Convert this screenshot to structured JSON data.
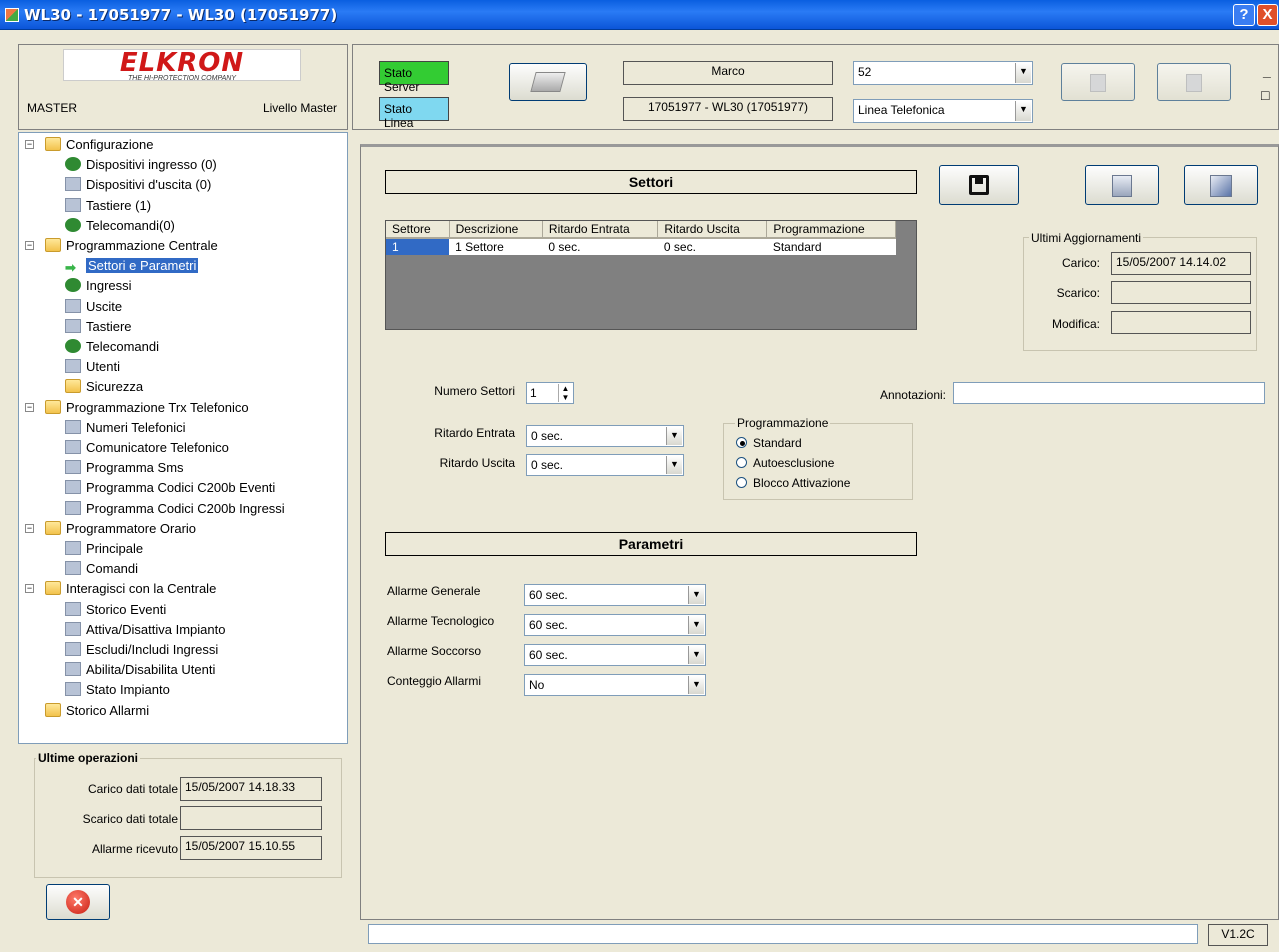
{
  "window": {
    "title": "WL30 - 17051977 - WL30 (17051977)",
    "help_label": "?",
    "close_label": "X"
  },
  "brand": {
    "logo_text": "ELKRON",
    "tagline": "THE HI-PROTECTION COMPANY",
    "user": "MASTER",
    "level": "Livello Master"
  },
  "tree": [
    {
      "label": "Configurazione",
      "icon": "folder-icon"
    },
    {
      "label": "Dispositivi ingresso (0)",
      "icon": "input-device-icon"
    },
    {
      "label": "Dispositivi d'uscita (0)",
      "icon": "speaker-icon"
    },
    {
      "label": "Tastiere (1)",
      "icon": "keyboard-icon"
    },
    {
      "label": "Telecomandi(0)",
      "icon": "remote-icon"
    },
    {
      "label": "Programmazione Centrale",
      "icon": "folder-icon"
    },
    {
      "label": "Settori e Parametri",
      "icon": "arrow-icon"
    },
    {
      "label": "Ingressi",
      "icon": "input-device-icon"
    },
    {
      "label": "Uscite",
      "icon": "speaker-icon"
    },
    {
      "label": "Tastiere",
      "icon": "keyboard-icon"
    },
    {
      "label": "Telecomandi",
      "icon": "remote-icon"
    },
    {
      "label": "Utenti",
      "icon": "users-icon"
    },
    {
      "label": "Sicurezza",
      "icon": "lock-icon"
    },
    {
      "label": "Programmazione Trx Telefonico",
      "icon": "folder-icon"
    },
    {
      "label": "Numeri Telefonici",
      "icon": "phonebook-icon"
    },
    {
      "label": "Comunicatore Telefonico",
      "icon": "phone-icon"
    },
    {
      "label": "Programma Sms",
      "icon": "mobile-icon"
    },
    {
      "label": "Programma Codici C200b Eventi",
      "icon": "grid-icon"
    },
    {
      "label": "Programma Codici C200b Ingressi",
      "icon": "grid-icon"
    },
    {
      "label": "Programmatore Orario",
      "icon": "folder-icon"
    },
    {
      "label": "Principale",
      "icon": "clock-icon"
    },
    {
      "label": "Comandi",
      "icon": "clock-icon"
    },
    {
      "label": "Interagisci con la Centrale",
      "icon": "folder-icon"
    },
    {
      "label": "Storico Eventi",
      "icon": "list-icon"
    },
    {
      "label": "Attiva/Disattiva Impianto",
      "icon": "list-icon"
    },
    {
      "label": "Escludi/Includi Ingressi",
      "icon": "list-icon"
    },
    {
      "label": "Abilita/Disabilita Utenti",
      "icon": "list-icon"
    },
    {
      "label": "Stato Impianto",
      "icon": "list-icon"
    },
    {
      "label": "Storico Allarmi",
      "icon": "folder-icon"
    }
  ],
  "ops": {
    "title": "Ultime operazioni",
    "carico_label": "Carico dati totale",
    "carico_value": "15/05/2007 14.18.33",
    "scarico_label": "Scarico dati totale",
    "scarico_value": "",
    "allarme_label": "Allarme ricevuto",
    "allarme_value": "15/05/2007 15.10.55"
  },
  "top": {
    "stato_server": "Stato Server",
    "stato_linea": "Stato Linea",
    "user_name": "Marco",
    "device": "17051977 - WL30 (17051977)",
    "combo1": "52",
    "combo2": "Linea Telefonica",
    "min_label": "_",
    "max_label": "□"
  },
  "settori": {
    "title": "Settori",
    "columns": [
      "Settore",
      "Descrizione",
      "Ritardo Entrata",
      "Ritardo Uscita",
      "Programmazione"
    ],
    "rows": [
      [
        "1",
        "1 Settore",
        "0 sec.",
        "0 sec.",
        "Standard"
      ]
    ]
  },
  "updates": {
    "title": "Ultimi Aggiornamenti",
    "carico_label": "Carico:",
    "carico_value": "15/05/2007 14.14.02",
    "scarico_label": "Scarico:",
    "scarico_value": "",
    "modifica_label": "Modifica:",
    "modifica_value": ""
  },
  "form": {
    "numero_settori_label": "Numero Settori",
    "numero_settori_value": "1",
    "annotazioni_label": "Annotazioni:",
    "annotazioni_value": "",
    "ritardo_entrata_label": "Ritardo Entrata",
    "ritardo_entrata_value": "0 sec.",
    "ritardo_uscita_label": "Ritardo Uscita",
    "ritardo_uscita_value": "0 sec.",
    "prog_title": "Programmazione",
    "radios": [
      "Standard",
      "Autoesclusione",
      "Blocco Attivazione"
    ],
    "radio_selected": 0
  },
  "parametri": {
    "title": "Parametri",
    "items": [
      {
        "label": "Allarme Generale",
        "value": "60 sec."
      },
      {
        "label": "Allarme Tecnologico",
        "value": "60 sec."
      },
      {
        "label": "Allarme Soccorso",
        "value": "60 sec."
      },
      {
        "label": "Conteggio Allarmi",
        "value": "No"
      }
    ]
  },
  "status": {
    "version": "V1.2C",
    "message": ""
  },
  "colors": {
    "title_bar": "#0a5fe0",
    "status_green": "#33cc33",
    "status_cyan": "#7fd8f0",
    "selected": "#316ac5",
    "grid_empty": "#808080"
  }
}
